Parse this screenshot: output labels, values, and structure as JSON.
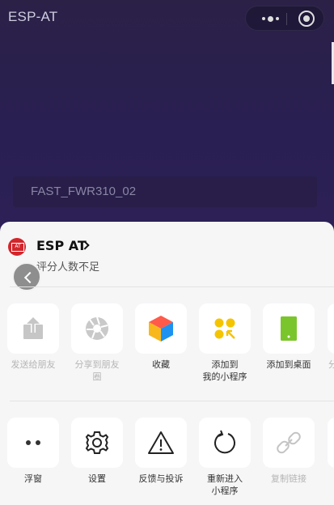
{
  "header": {
    "title": "ESP-AT"
  },
  "content": {
    "wifi_ssid": "FAST_FWR310_02"
  },
  "sheet": {
    "app_name": "ESP AT",
    "rating_text": "评分人数不足",
    "row1": [
      {
        "label": "发送给朋友",
        "icon": "share-icon",
        "enabled": false
      },
      {
        "label": "分享到朋友\n圈",
        "icon": "moments-icon",
        "enabled": false
      },
      {
        "label": "收藏",
        "icon": "favorite-cube-icon",
        "enabled": true
      },
      {
        "label": "添加到\n我的小程序",
        "icon": "add-miniprogram-icon",
        "enabled": true
      },
      {
        "label": "添加到桌面",
        "icon": "phone-desktop-icon",
        "enabled": true
      },
      {
        "label": "分",
        "icon": "partial-icon",
        "enabled": false
      }
    ],
    "row2": [
      {
        "label": "浮窗",
        "icon": "float-window-icon",
        "enabled": true
      },
      {
        "label": "设置",
        "icon": "gear-icon",
        "enabled": true
      },
      {
        "label": "反馈与投诉",
        "icon": "warning-icon",
        "enabled": true
      },
      {
        "label": "重新进入\n小程序",
        "icon": "reload-icon",
        "enabled": true
      },
      {
        "label": "复制链接",
        "icon": "link-icon",
        "enabled": false
      }
    ]
  },
  "colors": {
    "background_top": "#2b2147",
    "sheet_bg": "#f6f6f7",
    "logo_red": "#d3252b",
    "add_yellow": "#f5c400",
    "desktop_green": "#7bc52c"
  }
}
